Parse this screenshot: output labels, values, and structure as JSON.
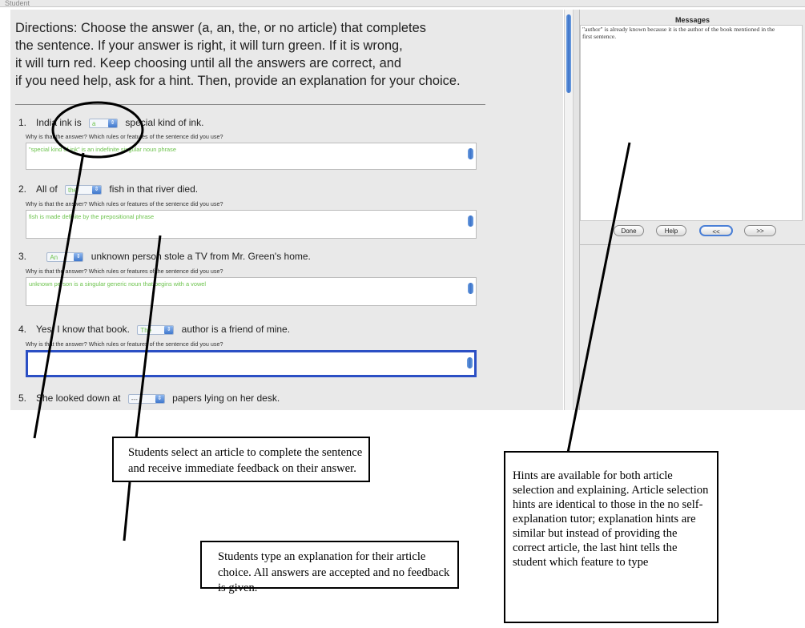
{
  "window": {
    "title": "Student"
  },
  "directions": {
    "lines": [
      "Directions: Choose the answer (a, an, the, or no article) that completes",
      "the sentence. If your answer is right, it will turn green. If it is wrong,",
      "it will turn red. Keep choosing until all the answers are correct, and",
      "if you need help, ask for a hint. Then, provide an explanation for your choice."
    ]
  },
  "why_prompt": "Why is that the answer? Which rules or features of the sentence did you use?",
  "questions": [
    {
      "num": "1.",
      "before": "India ink is",
      "choice": "a",
      "after": "special kind of ink.",
      "explanation": "\"special kind of ink\" is an indefinite singular noun phrase"
    },
    {
      "num": "2.",
      "before": "All of",
      "choice": "the",
      "after": "fish in that river died.",
      "explanation": "fish is made definite by the prepositional phrase"
    },
    {
      "num": "3.",
      "before": "",
      "choice": "An",
      "after": "unknown person stole a TV from Mr. Green's home.",
      "explanation": "unknown person is a singular generic noun that begins with a vowel"
    },
    {
      "num": "4.",
      "before": "Yes, I know that book.",
      "choice": "The",
      "after": "author is a friend of mine.",
      "explanation": ""
    },
    {
      "num": "5.",
      "before": "She looked down at",
      "choice": "---",
      "after": "papers lying on her desk.",
      "explanation": ""
    }
  ],
  "messages": {
    "title": "Messages",
    "text": "\"author\" is already known because it is the author of the book mentioned in the first sentence."
  },
  "buttons": {
    "done": "Done",
    "help": "Help",
    "prev": "<<",
    "next": ">>"
  },
  "annotations": {
    "select": "Students select an article to complete the sentence and receive immediate feedback on their answer.",
    "explain": "Students type an explanation for their article choice. All answers are accepted and no feedback is given.",
    "hints": "Hints are available for both article selection and explaining. Article selection hints are identical to those in the no self-explanation tutor; explanation hints are similar but instead of providing the correct article, the last hint tells the student which feature to type"
  },
  "colors": {
    "correct": "#6cc34c",
    "focus": "#2b4fc4",
    "scroll": "#3b73c9"
  }
}
